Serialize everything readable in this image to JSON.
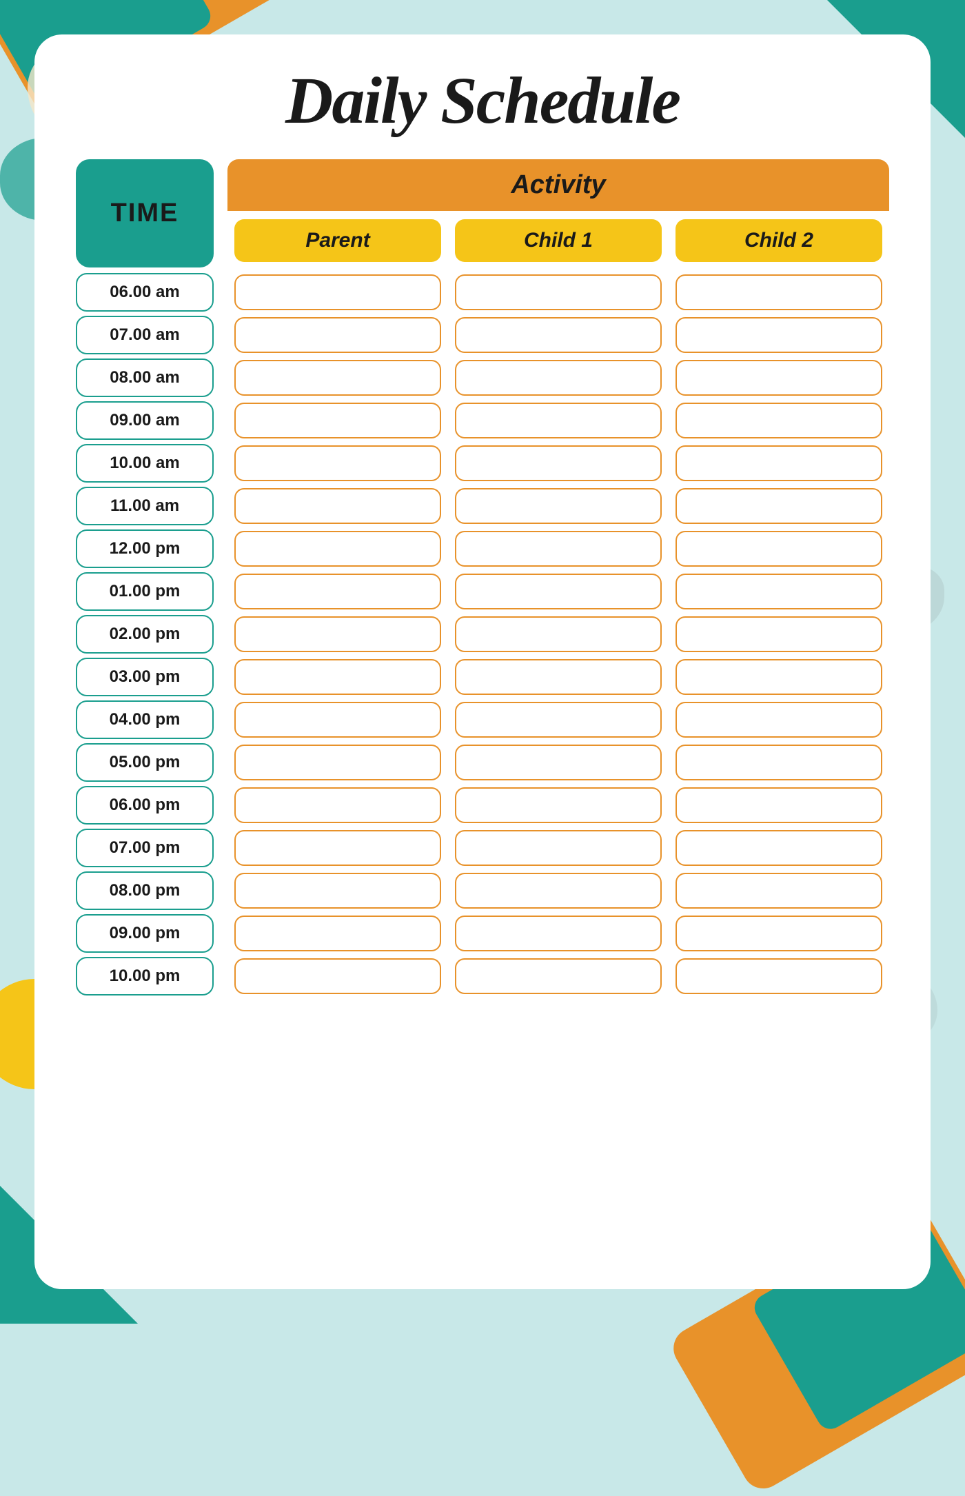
{
  "title": "Daily Schedule",
  "header": {
    "time_label": "TIME",
    "activity_label": "Activity",
    "sub_headers": [
      "Parent",
      "Child 1",
      "Child 2"
    ]
  },
  "time_slots": [
    "06.00 am",
    "07.00 am",
    "08.00 am",
    "09.00 am",
    "10.00 am",
    "11.00 am",
    "12.00 pm",
    "01.00 pm",
    "02.00 pm",
    "03.00 pm",
    "04.00 pm",
    "05.00 pm",
    "06.00 pm",
    "07.00 pm",
    "08.00 pm",
    "09.00 pm",
    "10.00 pm"
  ],
  "colors": {
    "teal": "#1a9e8e",
    "orange": "#E8922A",
    "yellow": "#F5C518",
    "bg": "#c8e8e8",
    "card": "#ffffff"
  }
}
